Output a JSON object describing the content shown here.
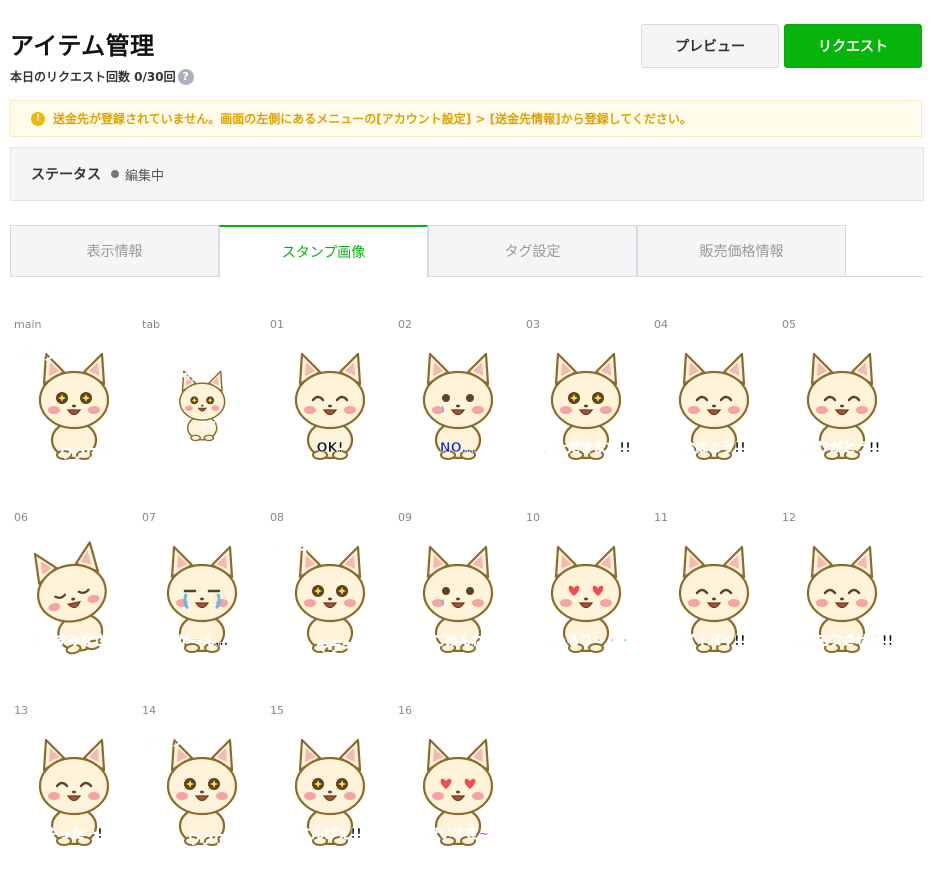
{
  "header": {
    "title": "アイテム管理",
    "request_count": "本日のリクエスト回数 0/30回",
    "help_glyph": "?",
    "preview_label": "プレビュー",
    "request_label": "リクエスト"
  },
  "notice": {
    "icon_glyph": "!",
    "text": "送金先が登録されていません。画面の左側にあるメニューの[アカウント設定] > [送金先情報]から登録してください。"
  },
  "status": {
    "label": "ステータス",
    "value": "編集中"
  },
  "tabs": [
    {
      "label": "表示情報",
      "active": false
    },
    {
      "label": "スタンプ画像",
      "active": true
    },
    {
      "label": "タグ設定",
      "active": false
    },
    {
      "label": "販売価格情報",
      "active": false
    }
  ],
  "stickers": [
    {
      "label": "main",
      "caption": "ワクワク",
      "caption2": "ワクワク",
      "caption_color": "#e8128c",
      "eyes": "star"
    },
    {
      "label": "tab",
      "caption": "ワクワク",
      "caption2": "ワクワク",
      "caption_color": "#e8128c",
      "eyes": "star"
    },
    {
      "label": "01",
      "caption": "OK!",
      "caption2": "",
      "caption_color": "#111111",
      "eyes": "closed"
    },
    {
      "label": "02",
      "caption": "NO...",
      "caption2": "",
      "caption_color": "#1a2fd1",
      "eyes": "sad"
    },
    {
      "label": "03",
      "caption": "いただきます!!",
      "caption2": "",
      "caption_color": "#111111",
      "eyes": "star"
    },
    {
      "label": "04",
      "caption": "おはよう!!",
      "caption2": "",
      "caption_color": "#111111",
      "eyes": "closed"
    },
    {
      "label": "05",
      "caption": "ありがとう!!",
      "caption2": "",
      "caption_color": "#111111",
      "eyes": "closed"
    },
    {
      "label": "06",
      "caption": "おやすみなさい",
      "caption2": "",
      "caption_color": "#1aa5e0",
      "eyes": "sleep"
    },
    {
      "label": "07",
      "caption": "がーん…",
      "caption2": "",
      "caption_color": "#111111",
      "eyes": "cry"
    },
    {
      "label": "08",
      "caption": "キラキラ",
      "caption2": "キラキラ",
      "caption_color": "#2fb52f",
      "eyes": "star"
    },
    {
      "label": "09",
      "caption": "ごめんね",
      "caption2": "",
      "caption_color": "#19c7d6",
      "eyes": "sad"
    },
    {
      "label": "10",
      "caption": "じゅるり・・・",
      "caption2": "",
      "caption_color": "#19c7d6",
      "eyes": "heart"
    },
    {
      "label": "11",
      "caption": "バイバイ!!",
      "caption2": "",
      "caption_color": "#111111",
      "eyes": "closed"
    },
    {
      "label": "12",
      "caption": "モフモフさせて!!",
      "caption2": "",
      "caption_color": "#111111",
      "eyes": "closed"
    },
    {
      "label": "13",
      "caption": "やったー!",
      "caption2": "",
      "caption_color": "#111111",
      "eyes": "closed"
    },
    {
      "label": "14",
      "caption": "ワクワク",
      "caption2": "ワクワク",
      "caption_color": "#e8128c",
      "eyes": "star"
    },
    {
      "label": "15",
      "caption": "すんげぇ!!",
      "caption2": "",
      "caption_color": "#111111",
      "eyes": "star"
    },
    {
      "label": "16",
      "caption": "だいすき~",
      "caption2": "",
      "caption_color": "#d91bd9",
      "eyes": "heart"
    }
  ],
  "colors": {
    "accent": "#06b40b",
    "warning": "#e0a200",
    "cat_fur": "#fff3d9",
    "cat_outline": "#8b6a2e",
    "cheek": "#f7a3a3"
  }
}
